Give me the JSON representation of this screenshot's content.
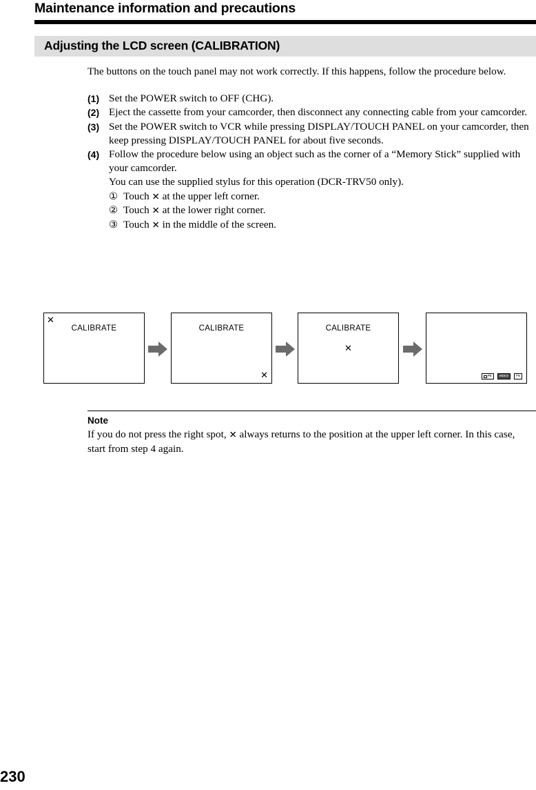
{
  "header": {
    "running_title": "Maintenance information and precautions"
  },
  "section": {
    "title": "Adjusting the LCD screen (CALIBRATION)"
  },
  "body": {
    "intro": "The buttons on the touch panel may not work correctly. If this happens, follow the procedure below.",
    "steps": [
      {
        "number": "(1)",
        "text": "Set the POWER switch to OFF (CHG)."
      },
      {
        "number": "(2)",
        "text": "Eject the cassette from your camcorder, then disconnect any connecting cable from your camcorder."
      },
      {
        "number": "(3)",
        "text": "Set the POWER switch to VCR while pressing DISPLAY/TOUCH PANEL on your camcorder, then keep pressing DISPLAY/TOUCH PANEL for about five seconds."
      },
      {
        "number": "(4)",
        "text": "Follow the procedure below using an object such as the corner of a “Memory Stick” supplied with your camcorder.",
        "extra_line": "You can use the supplied stylus for this operation (DCR-TRV50 only).",
        "substeps": [
          {
            "marker": "①",
            "text_before": "Touch",
            "symbol": "✕",
            "text_after": "at the upper left corner."
          },
          {
            "marker": "②",
            "text_before": "Touch",
            "symbol": "✕",
            "text_after": "at the lower right corner."
          },
          {
            "marker": "③",
            "text_before": "Touch",
            "symbol": "✕",
            "text_after": "in the middle of the screen."
          }
        ]
      }
    ]
  },
  "figure": {
    "panels": [
      {
        "label": "CALIBRATE",
        "x_mark": "✕",
        "x_position": "upper-left"
      },
      {
        "label": "CALIBRATE",
        "x_mark": "✕",
        "x_position": "lower-right"
      },
      {
        "label": "CALIBRATE",
        "x_mark": "✕",
        "x_position": "center"
      },
      {
        "label": "",
        "x_mark": "",
        "x_position": "none",
        "softkeys": [
          {
            "label": "PB",
            "style": "normal",
            "has_box_icon": true
          },
          {
            "label": "INDEX",
            "style": "inverted",
            "has_box_icon": false
          },
          {
            "label": "FN",
            "style": "normal",
            "has_box_icon": false
          }
        ]
      }
    ],
    "arrow_color": "#6b6b6b",
    "arrow_count": 3
  },
  "note": {
    "heading": "Note",
    "text_before": "If you do not press the right spot,",
    "symbol": "✕",
    "text_after": "always returns to the position at the upper left corner. In this case, start from step 4 again."
  },
  "folio": {
    "page_number": "230"
  },
  "colors": {
    "section_band": "#dedede",
    "rule": "#000000",
    "arrow": "#6b6b6b",
    "softkey_inverted": "#4a4a4a"
  }
}
